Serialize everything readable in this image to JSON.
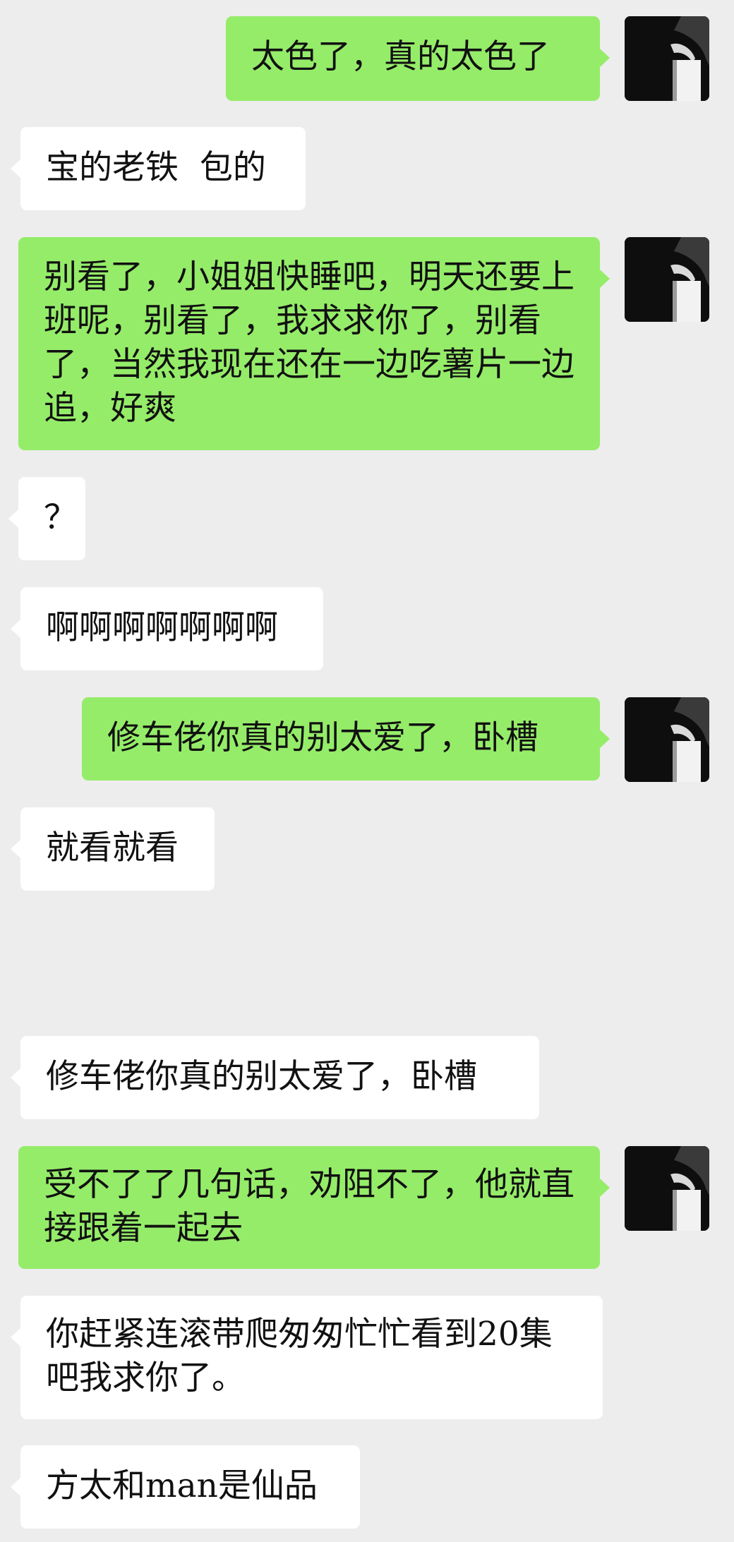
{
  "messages": [
    {
      "side": "sent",
      "text": "太色了，真的太色了"
    },
    {
      "side": "received",
      "text": "宝的老铁  包的"
    },
    {
      "side": "sent",
      "text": "别看了，小姐姐快睡吧，明天还要上班呢，别看了，我求求你了，别看了，当然我现在还在一边吃薯片一边追，好爽"
    },
    {
      "side": "received",
      "text": "？"
    },
    {
      "side": "received",
      "text": "啊啊啊啊啊啊啊"
    },
    {
      "side": "sent",
      "text": "修车佬你真的别太爱了，卧槽"
    },
    {
      "side": "received",
      "text": "就看就看"
    },
    {
      "side": "received",
      "text": "修车佬你真的别太爱了，卧槽"
    },
    {
      "side": "sent",
      "text": "受不了了几句话，劝阻不了，他就直接跟着一起去"
    },
    {
      "side": "received",
      "text": "你赶紧连滚带爬匆匆忙忙看到20集吧我求你了。"
    },
    {
      "side": "received",
      "text": "方太和man是仙品"
    }
  ],
  "colors": {
    "background": "#ededed",
    "sent_bubble": "#95ec69",
    "received_bubble": "#ffffff",
    "text": "#111111"
  },
  "icons": {
    "avatar": "user-avatar-icon"
  }
}
